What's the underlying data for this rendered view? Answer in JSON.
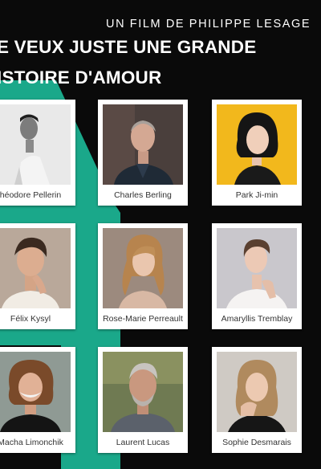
{
  "header": {
    "credit": "UN FILM DE PHILIPPE LESAGE",
    "title_line1": "E VEUX JUSTE UNE GRANDE",
    "title_line2": "ISTOIRE D'AMOUR"
  },
  "colors": {
    "background": "#0a0a0a",
    "accent_teal": "#1aa88a",
    "card": "#ffffff"
  },
  "cast": [
    {
      "name": "héodore Pellerin",
      "photo": "bw-portrait-man"
    },
    {
      "name": "Charles Berling",
      "photo": "portrait-man-grey-hair"
    },
    {
      "name": "Park  Ji-min",
      "photo": "portrait-woman-yellow-bg"
    },
    {
      "name": "Félix Kysyl",
      "photo": "portrait-man-hand-on-chin"
    },
    {
      "name": "Rose-Marie Perreault",
      "photo": "portrait-woman-blonde"
    },
    {
      "name": "Amaryllis Tremblay",
      "photo": "portrait-woman-white-top"
    },
    {
      "name": "Macha Limonchik",
      "photo": "portrait-woman-curly-hair"
    },
    {
      "name": "Laurent Lucas",
      "photo": "portrait-man-grey-beard"
    },
    {
      "name": "Sophie Desmarais",
      "photo": "portrait-woman-wavy-hair"
    }
  ]
}
